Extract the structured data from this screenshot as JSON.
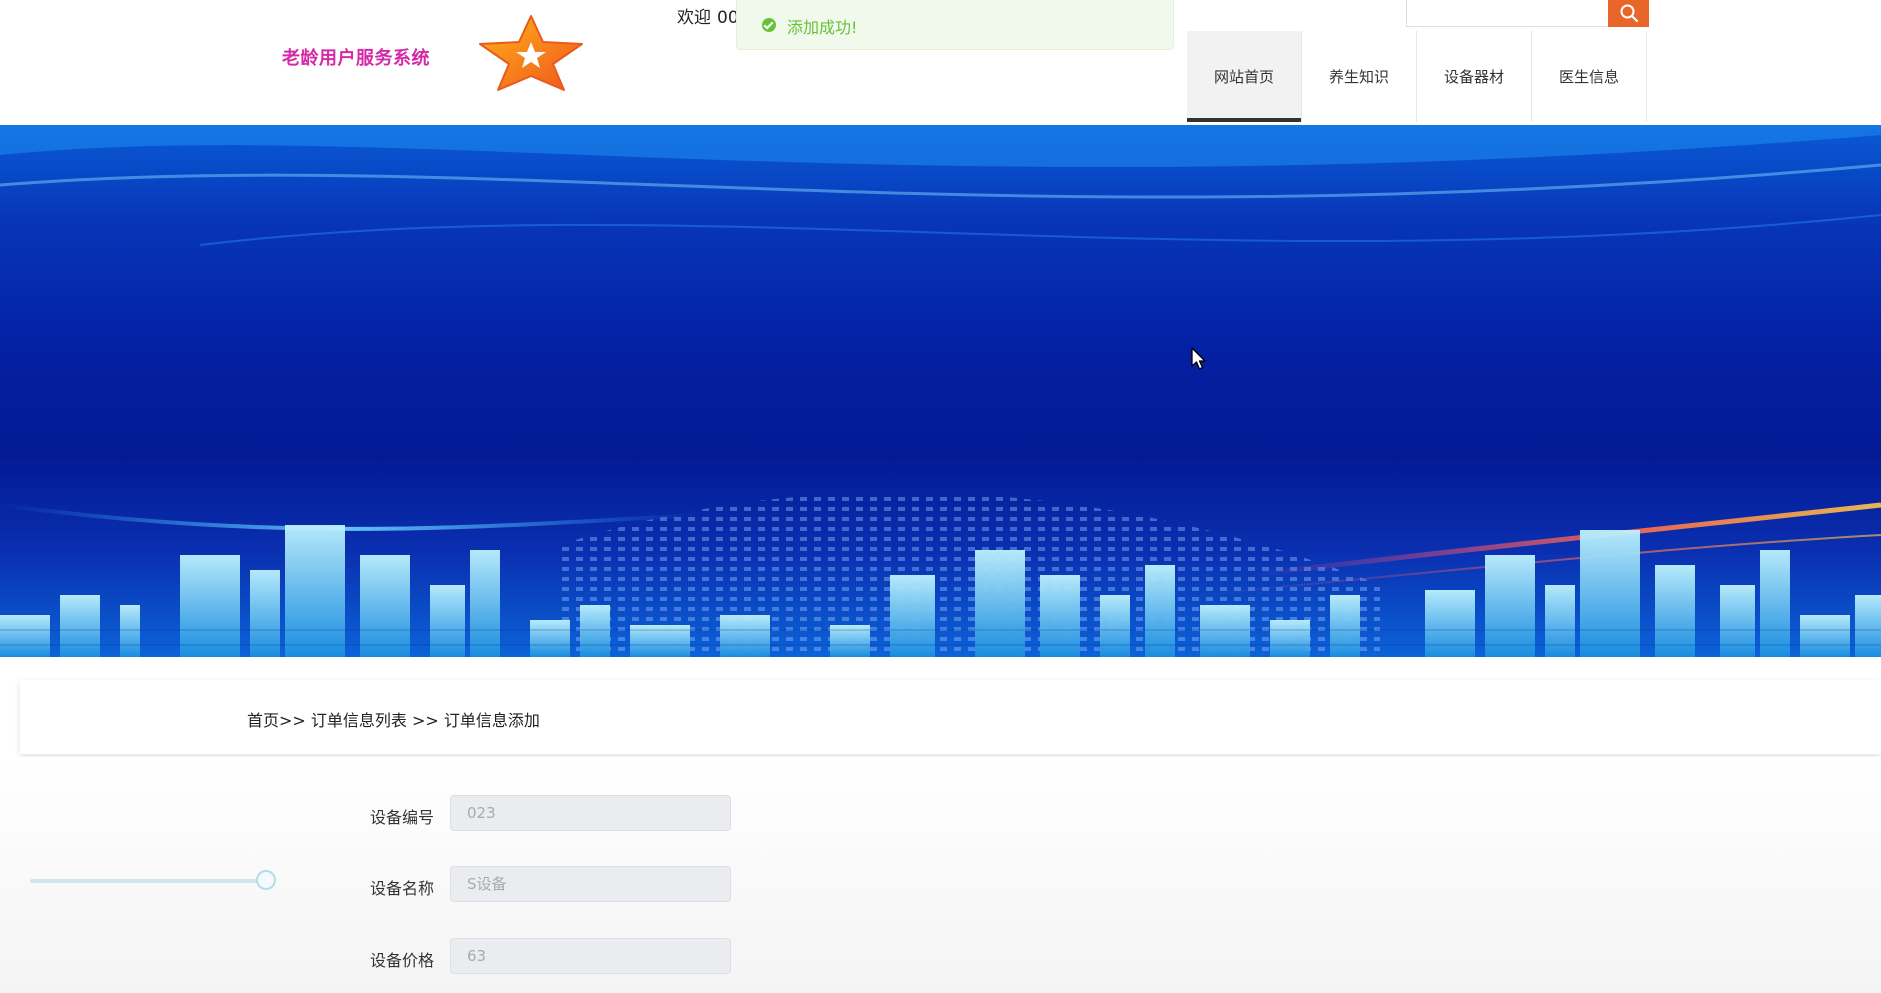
{
  "header": {
    "brand": "老龄用户服务系统",
    "welcome_label": "欢迎",
    "username": "00",
    "logo_icon": "star-logo-icon",
    "search_icon": "search-icon",
    "nav": [
      {
        "label": "网站首页",
        "active": true
      },
      {
        "label": "养生知识",
        "active": false
      },
      {
        "label": "设备器材",
        "active": false
      },
      {
        "label": "医生信息",
        "active": false
      }
    ]
  },
  "toast": {
    "message": "添加成功!",
    "icon": "success-check-icon",
    "color": "#67c23a"
  },
  "breadcrumb": {
    "text": "首页>> 订单信息列表 >> 订单信息添加"
  },
  "form": {
    "fields": [
      {
        "label": "设备编号",
        "value": "023"
      },
      {
        "label": "设备名称",
        "value": "S设备"
      },
      {
        "label": "设备价格",
        "value": "63"
      }
    ]
  },
  "colors": {
    "brand": "#d42aa8",
    "accent": "#e8662a",
    "success": "#67c23a"
  }
}
